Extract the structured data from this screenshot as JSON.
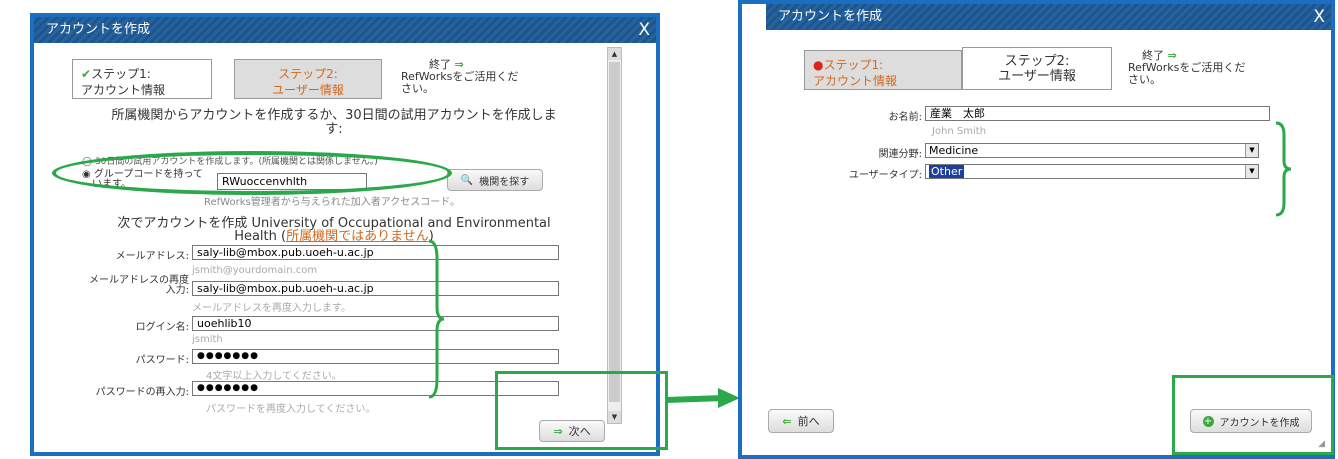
{
  "left": {
    "title": "アカウントを作成",
    "close": "X",
    "steps": {
      "step1_line1": "ステップ1:",
      "step1_line2": "アカウント情報",
      "step2_line1": "ステップ2:",
      "step2_line2": "ユーザー情報",
      "done_label": "終了",
      "done_line1": "RefWorksをご活用くだ",
      "done_line2": "さい。"
    },
    "intro_line1": "所属機関からアカウントを作成するか、30日間の試用アカウントを作成しま",
    "intro_line2": "す:",
    "trial_option": "30日間の試用アカウントを作成します。(所属機関とは関係しません。)",
    "group_option_line1": "グループコードを持って",
    "group_option_line2": "います。",
    "group_code": "RWuoccenvhlth",
    "find_institution": "機関を探す",
    "group_hint": "RefWorks管理者から与えられた加入者アクセスコード。",
    "create_with_line1": "次でアカウントを作成 University of Occupational and Environmental",
    "create_with_line2_a": "Health (",
    "create_with_link": "所属機関ではありません",
    "create_with_line2_b": ")",
    "email_label": "メールアドレス:",
    "email_value": "saly-lib@mbox.pub.uoeh-u.ac.jp",
    "email_hint": "jsmith@yourdomain.com",
    "email2_label_line1": "メールアドレスの再度",
    "email2_label_line2": "入力:",
    "email2_value": "saly-lib@mbox.pub.uoeh-u.ac.jp",
    "email2_hint": "メールアドレスを再度入力します。",
    "login_label": "ログイン名:",
    "login_value": "uoehlib10",
    "login_hint": "jsmith",
    "password_label": "パスワード:",
    "password_value": "●●●●●●●",
    "password_hint": "4文字以上入力してください。",
    "password2_label": "パスワードの再入力:",
    "password2_value": "●●●●●●●",
    "password2_hint": "パスワードを再度入力してください。",
    "next_button": "次へ"
  },
  "right": {
    "title": "アカウントを作成",
    "close": "X",
    "steps": {
      "step1_line1": "ステップ1:",
      "step1_line2": "アカウント情報",
      "step2_line1": "ステップ2:",
      "step2_line2": "ユーザー情報",
      "done_label": "終了",
      "done_line1": "RefWorksをご活用くだ",
      "done_line2": "さい。"
    },
    "name_label": "お名前:",
    "name_value": "産業　太郎",
    "name_hint": "John Smith",
    "field_label": "関連分野:",
    "field_value": "Medicine",
    "usertype_label": "ユーザータイプ:",
    "usertype_value": "Other",
    "back_button": "前へ",
    "create_button": "アカウントを作成"
  },
  "colors": {
    "frame_blue": "#1b6fc2",
    "title_bar": "#1c5a97",
    "annotation_green": "#2aa84a",
    "inactive_step_text": "#d2691e"
  }
}
